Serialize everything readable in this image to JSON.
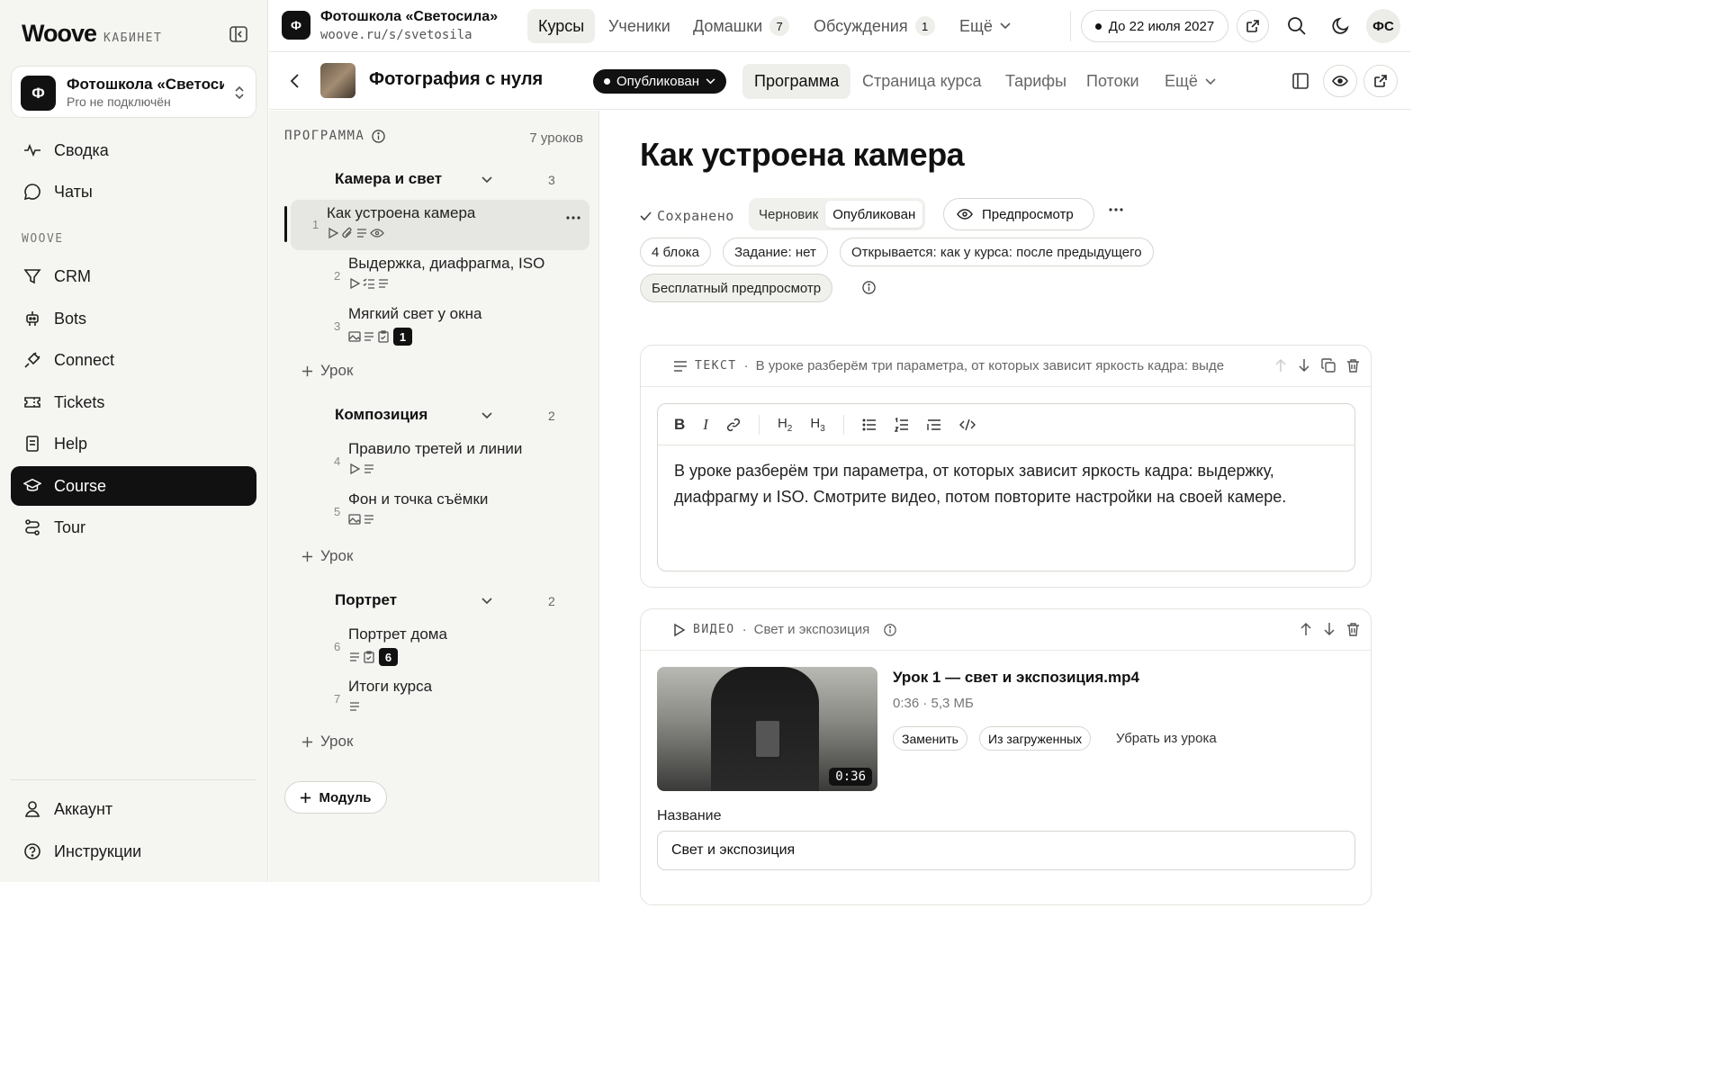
{
  "sidebar": {
    "brand": "Woove",
    "brand_sub": "КАБИНЕТ",
    "workspace": {
      "avatar": "Ф",
      "title": "Фотошкола «Светосила»",
      "subtitle": "Pro не подключён"
    },
    "nav_top": [
      {
        "label": "Сводка",
        "icon": "activity-icon"
      },
      {
        "label": "Чаты",
        "icon": "chat-icon"
      }
    ],
    "section_label": "WOOVE",
    "nav_main": [
      {
        "label": "CRM",
        "icon": "funnel-icon"
      },
      {
        "label": "Bots",
        "icon": "robot-icon"
      },
      {
        "label": "Connect",
        "icon": "plug-icon"
      },
      {
        "label": "Tickets",
        "icon": "ticket-icon"
      },
      {
        "label": "Help",
        "icon": "book-icon"
      },
      {
        "label": "Course",
        "icon": "graduation-cap-icon",
        "active": true
      },
      {
        "label": "Tour",
        "icon": "route-icon"
      }
    ],
    "nav_bottom": [
      {
        "label": "Аккаунт",
        "icon": "user-icon"
      },
      {
        "label": "Инструкции",
        "icon": "help-circle-icon"
      }
    ]
  },
  "topbar": {
    "school_avatar": "Ф",
    "school_title": "Фотошкола «Светосила»",
    "school_url": "woove.ru/s/svetosila",
    "tabs": [
      {
        "label": "Курсы",
        "active": true
      },
      {
        "label": "Ученики"
      },
      {
        "label": "Домашки",
        "badge": "7"
      },
      {
        "label": "Обсуждения",
        "badge": "1"
      },
      {
        "label": "Ещё"
      }
    ],
    "plan_label": "До 22 июля 2027",
    "user_initials": "ФС"
  },
  "coursebar": {
    "title": "Фотография с нуля",
    "status": "Опубликован",
    "tabs": [
      {
        "label": "Программа",
        "active": true
      },
      {
        "label": "Страница курса"
      },
      {
        "label": "Тарифы"
      },
      {
        "label": "Потоки"
      },
      {
        "label": "Ещё"
      }
    ]
  },
  "program": {
    "header": "ПРОГРАММА",
    "count": "7 уроков",
    "add_lesson_label": "Урок",
    "add_module_label": "Модуль",
    "modules": [
      {
        "title": "Камера и свет",
        "count": "3",
        "lessons": [
          {
            "num": "1",
            "title": "Как устроена камера",
            "icons": [
              "play-icon",
              "paperclip-icon",
              "text-icon",
              "eye-icon"
            ],
            "active": true
          },
          {
            "num": "2",
            "title": "Выдержка, диафрагма, ISO",
            "icons": [
              "play-icon",
              "checklist-icon",
              "text-icon"
            ]
          },
          {
            "num": "3",
            "title": "Мягкий свет у окна",
            "icons": [
              "image-icon",
              "text-icon",
              "clipboard-icon"
            ],
            "badge": "1"
          }
        ]
      },
      {
        "title": "Композиция",
        "count": "2",
        "lessons": [
          {
            "num": "4",
            "title": "Правило третей и линии",
            "icons": [
              "play-icon",
              "text-icon"
            ]
          },
          {
            "num": "5",
            "title": "Фон и точка съёмки",
            "icons": [
              "image-icon",
              "text-icon"
            ]
          }
        ]
      },
      {
        "title": "Портрет",
        "count": "2",
        "lessons": [
          {
            "num": "6",
            "title": "Портрет дома",
            "icons": [
              "text-icon",
              "clipboard-icon"
            ],
            "badge": "6"
          },
          {
            "num": "7",
            "title": "Итоги курса",
            "icons": [
              "text-icon"
            ]
          }
        ]
      }
    ]
  },
  "editor": {
    "title": "Как устроена камера",
    "saved": "Сохранено",
    "seg_draft": "Черновик",
    "seg_published": "Опубликован",
    "preview": "Предпросмотр",
    "chips": [
      "4 блока",
      "Задание: нет",
      "Открывается: как у курса: после предыдущего"
    ],
    "free_preview": "Бесплатный предпросмотр",
    "text_block": {
      "type": "ТЕКСТ",
      "summary": "В уроке разберём три параметра, от которых зависит яркость кадра: выде",
      "content": "В уроке разберём три параметра, от которых зависит яркость кадра: выдержку, диафрагму и ISO. Смотрите видео, потом повторите настройки на своей камере."
    },
    "video_block": {
      "type": "ВИДЕО",
      "summary": "Свет и экспозиция",
      "filename": "Урок 1 — свет и экспозиция.mp4",
      "meta": "0:36 · 5,3 МБ",
      "duration": "0:36",
      "btn_replace": "Заменить",
      "btn_uploaded": "Из загруженных",
      "btn_remove": "Убрать из урока",
      "name_label": "Название",
      "name_value": "Свет и экспозиция"
    }
  }
}
